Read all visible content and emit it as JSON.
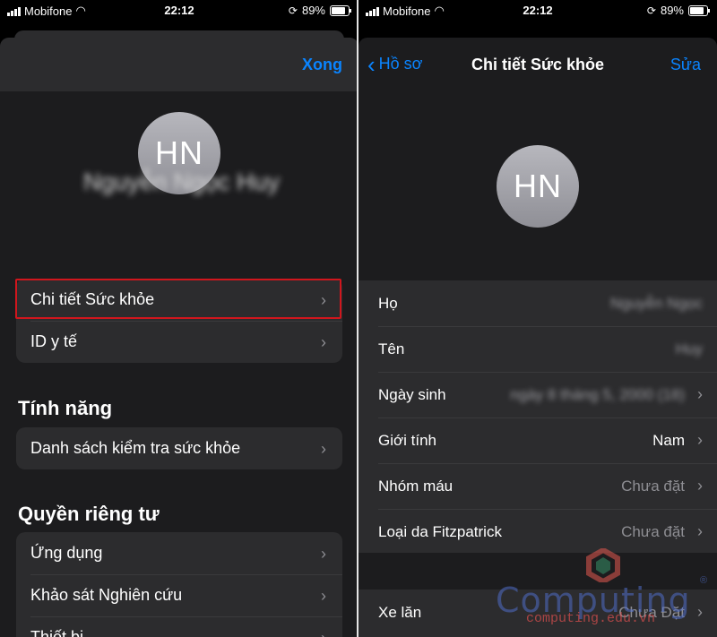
{
  "status_left": {
    "carrier": "Mobifone",
    "time": "22:12",
    "battery": "89%"
  },
  "status_right": {
    "carrier": "Mobifone",
    "time": "22:12",
    "battery": "89%"
  },
  "left": {
    "done_label": "Xong",
    "avatar_initials": "HN",
    "user_name": "Nguyễn Ngọc Huy",
    "profile_items": [
      {
        "label": "Chi tiết Sức khỏe"
      },
      {
        "label": "ID y tế"
      }
    ],
    "features_title": "Tính năng",
    "features_items": [
      {
        "label": "Danh sách kiểm tra sức khỏe"
      }
    ],
    "privacy_title": "Quyền riêng tư",
    "privacy_items": [
      {
        "label": "Ứng dụng"
      },
      {
        "label": "Khảo sát Nghiên cứu"
      },
      {
        "label": "Thiết bị"
      }
    ]
  },
  "right": {
    "back_label": "Hồ sơ",
    "title": "Chi tiết Sức khỏe",
    "edit_label": "Sửa",
    "avatar_initials": "HN",
    "fields": [
      {
        "label": "Họ",
        "value": "Nguyễn Ngọc"
      },
      {
        "label": "Tên",
        "value": "Huy"
      },
      {
        "label": "Ngày sinh",
        "value": "ngày 8 tháng 5, 2000 (18)"
      },
      {
        "label": "Giới tính",
        "value": "Nam"
      },
      {
        "label": "Nhóm máu",
        "value": "Chưa đặt"
      },
      {
        "label": "Loại da Fitzpatrick",
        "value": "Chưa đặt"
      }
    ],
    "wheelchair": {
      "label": "Xe lăn",
      "value": "Chưa Đặt"
    }
  },
  "watermark": {
    "brand": "Computing",
    "url": "computing.edu.vn",
    "reg": "®"
  },
  "colors": {
    "accent": "#0a84ff",
    "highlight_border": "#d0161d",
    "background": "#1c1c1e",
    "cell": "#2c2c2e"
  }
}
